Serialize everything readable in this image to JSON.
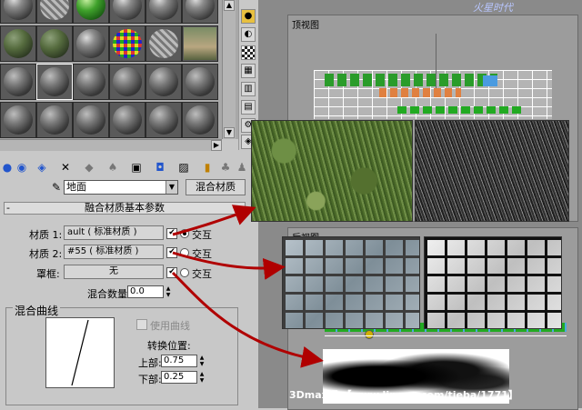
{
  "panel": {
    "material_name": "地面",
    "material_type": "混合材质",
    "rollout_title": "融合材质基本参数",
    "rollout_minus": "-",
    "material1_label": "材质 1:",
    "material1_value": "ault  ( 标准材质 )",
    "material2_label": "材质 2:",
    "material2_value": "#55  ( 标准材质 )",
    "mask_label": "罩框:",
    "mask_value": "无",
    "interactive_label": "交互",
    "mix_amount_label": "混合数量:",
    "mix_amount_value": "0.0",
    "curve_group_label": "混合曲线",
    "use_curve_label": "使用曲线",
    "transition_label": "转换位置:",
    "upper_label": "上部:",
    "upper_value": "0.75",
    "lower_label": "下部:",
    "lower_value": "0.25",
    "checkmark": "✔"
  },
  "viewports": {
    "top_label": "顶视图",
    "left_label": "后视图"
  },
  "watermark": "3Dmax吧 【www.lineeg.com/tieba/1771】",
  "logo_text": "火星时代"
}
